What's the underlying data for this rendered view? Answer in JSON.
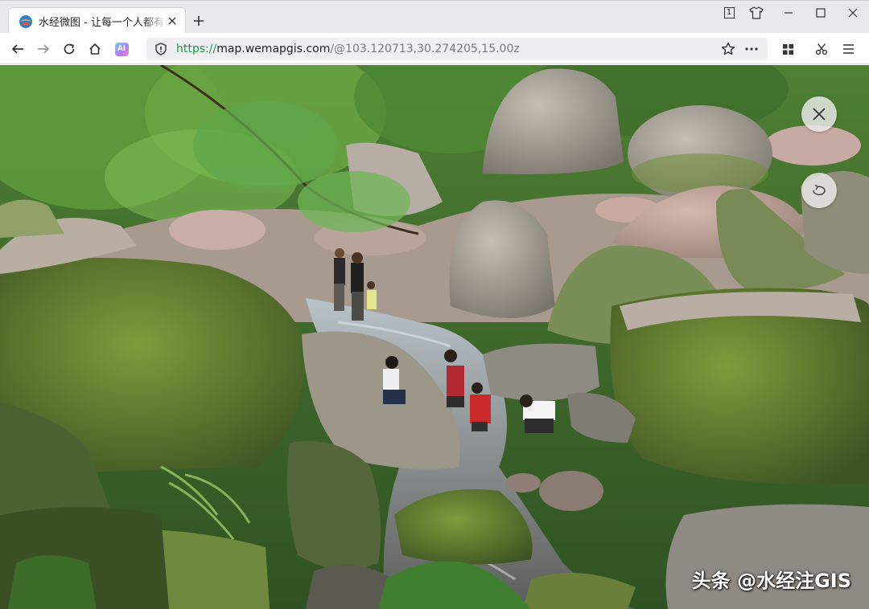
{
  "browser": {
    "tab": {
      "title": "水经微图 - 让每一个人都有自己的地图",
      "favicon": "wemapgis-logo-icon"
    },
    "window_controls": {
      "tab_count": "1",
      "icons": [
        "tab-counter-icon",
        "skin-shirt-icon",
        "minimize-icon",
        "maximize-icon",
        "close-icon"
      ]
    },
    "toolbar": {
      "icons": [
        "back-arrow-icon",
        "forward-arrow-icon",
        "reload-icon",
        "home-icon",
        "ai-assistant-icon",
        "extensions-grid-icon",
        "scissors-icon",
        "menu-icon"
      ],
      "ai_label": "AI"
    },
    "address_bar": {
      "scheme": "https://",
      "host": "map.wemapgis.com",
      "path": "/@103.120713,30.274205,15.00z",
      "security_icon": "shield-icon",
      "icons": [
        "bookmark-star-icon",
        "more-dots-icon"
      ]
    }
  },
  "viewer": {
    "controls": [
      "close-icon",
      "rotate-icon"
    ],
    "photo_subject": "streambed with mossy boulders and people playing in the water",
    "watermark": "头条 @水经注GIS"
  },
  "colors": {
    "url_scheme": "#1a9a47",
    "moss_green": "#6f8b3a",
    "rock_grey": "#a8a297"
  }
}
